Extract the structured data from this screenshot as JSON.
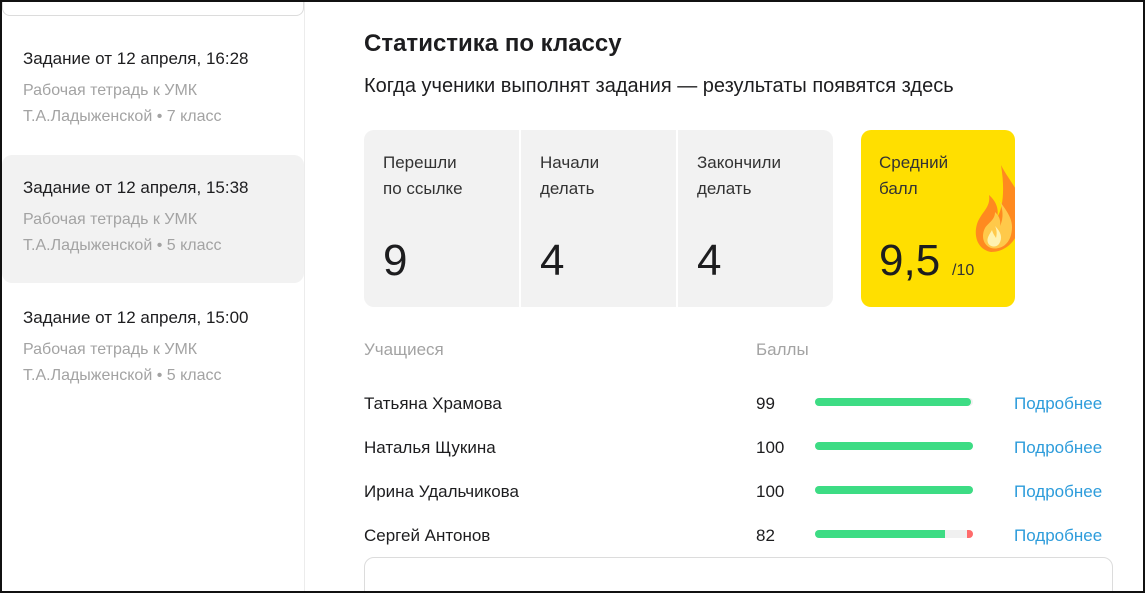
{
  "sidebar": {
    "tasks": [
      {
        "title": "Задание от 12 апреля, 16:28",
        "line1": "Рабочая тетрадь к УМК",
        "line2": "Т.А.Ладыженской • 7 класс",
        "selected": false
      },
      {
        "title": "Задание от 12 апреля, 15:38",
        "line1": "Рабочая тетрадь к УМК",
        "line2": "Т.А.Ладыженской • 5 класс",
        "selected": true
      },
      {
        "title": "Задание от 12 апреля, 15:00",
        "line1": "Рабочая тетрадь к УМК",
        "line2": "Т.А.Ладыженской • 5 класс",
        "selected": false
      }
    ]
  },
  "main": {
    "title": "Статистика по классу",
    "subtitle": "Когда ученики выполнят задания — результаты появятся здесь",
    "stats": [
      {
        "label_1": "Перешли",
        "label_2": "по ссылке",
        "value": "9"
      },
      {
        "label_1": "Начали",
        "label_2": "делать",
        "value": "4"
      },
      {
        "label_1": "Закончили",
        "label_2": "делать",
        "value": "4"
      }
    ],
    "average": {
      "label_1": "Средний",
      "label_2": "балл",
      "value": "9,5",
      "max": "/10",
      "color": "#ffdf00"
    },
    "table": {
      "col_students": "Учащиеся",
      "col_scores": "Баллы",
      "link_label": "Подробнее",
      "score_max": 100,
      "rows": [
        {
          "name": "Татьяна Храмова",
          "score": 99
        },
        {
          "name": "Наталья Щукина",
          "score": 100
        },
        {
          "name": "Ирина Удальчикова",
          "score": 100
        },
        {
          "name": "Сергей Антонов",
          "score": 82
        }
      ]
    },
    "colors": {
      "bar_good": "#3ddc84",
      "bar_bad": "#ff6b6b",
      "link": "#2d9cdb"
    }
  }
}
